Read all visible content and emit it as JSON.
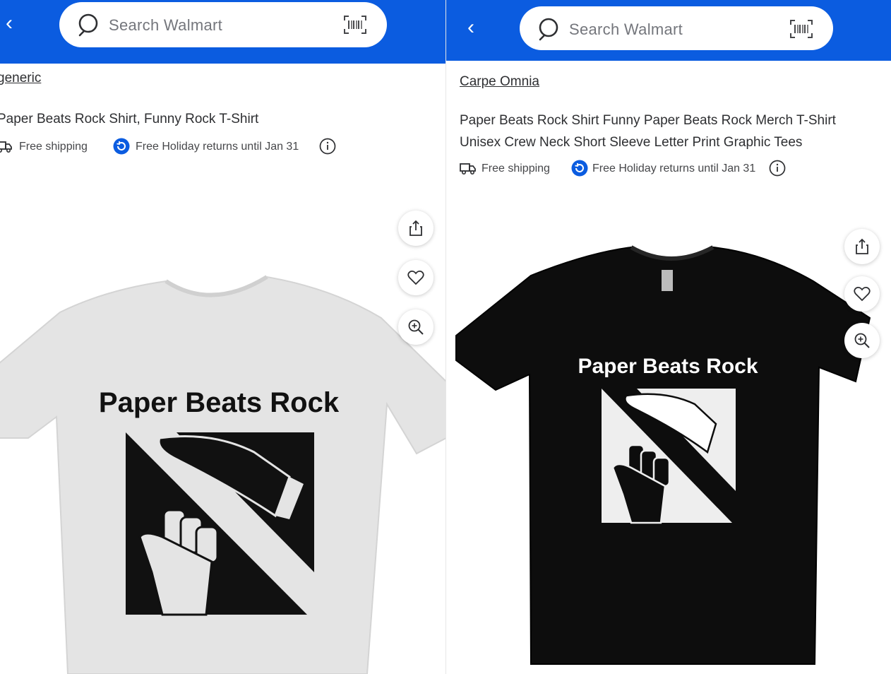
{
  "left": {
    "search": {
      "placeholder": "Search Walmart"
    },
    "seller": "generic",
    "title_lines": [
      "Paper Beats Rock Shirt, Funny Rock T-Shirt"
    ],
    "shipping": "Free shipping",
    "returns": "Free Holiday returns until Jan 31",
    "shirt": {
      "color": "white",
      "print": "Paper Beats Rock"
    }
  },
  "right": {
    "search": {
      "placeholder": "Search Walmart"
    },
    "seller": "Carpe Omnia",
    "title_lines": [
      "Paper Beats Rock Shirt Funny Paper Beats Rock Merch T-Shirt",
      "Unisex Crew Neck Short Sleeve Letter Print Graphic Tees"
    ],
    "shipping": "Free shipping",
    "returns": "Free Holiday returns until Jan 31",
    "shirt": {
      "color": "black",
      "print": "Paper Beats Rock"
    }
  },
  "icons": [
    "back-icon",
    "search-icon",
    "barcode-scan-icon",
    "truck-icon",
    "returns-icon",
    "info-icon",
    "share-icon",
    "heart-icon",
    "zoom-icon"
  ],
  "colors": {
    "header": "#0b5ce0",
    "returns_badge": "#0b5ce0",
    "text": "#2e2f32"
  }
}
